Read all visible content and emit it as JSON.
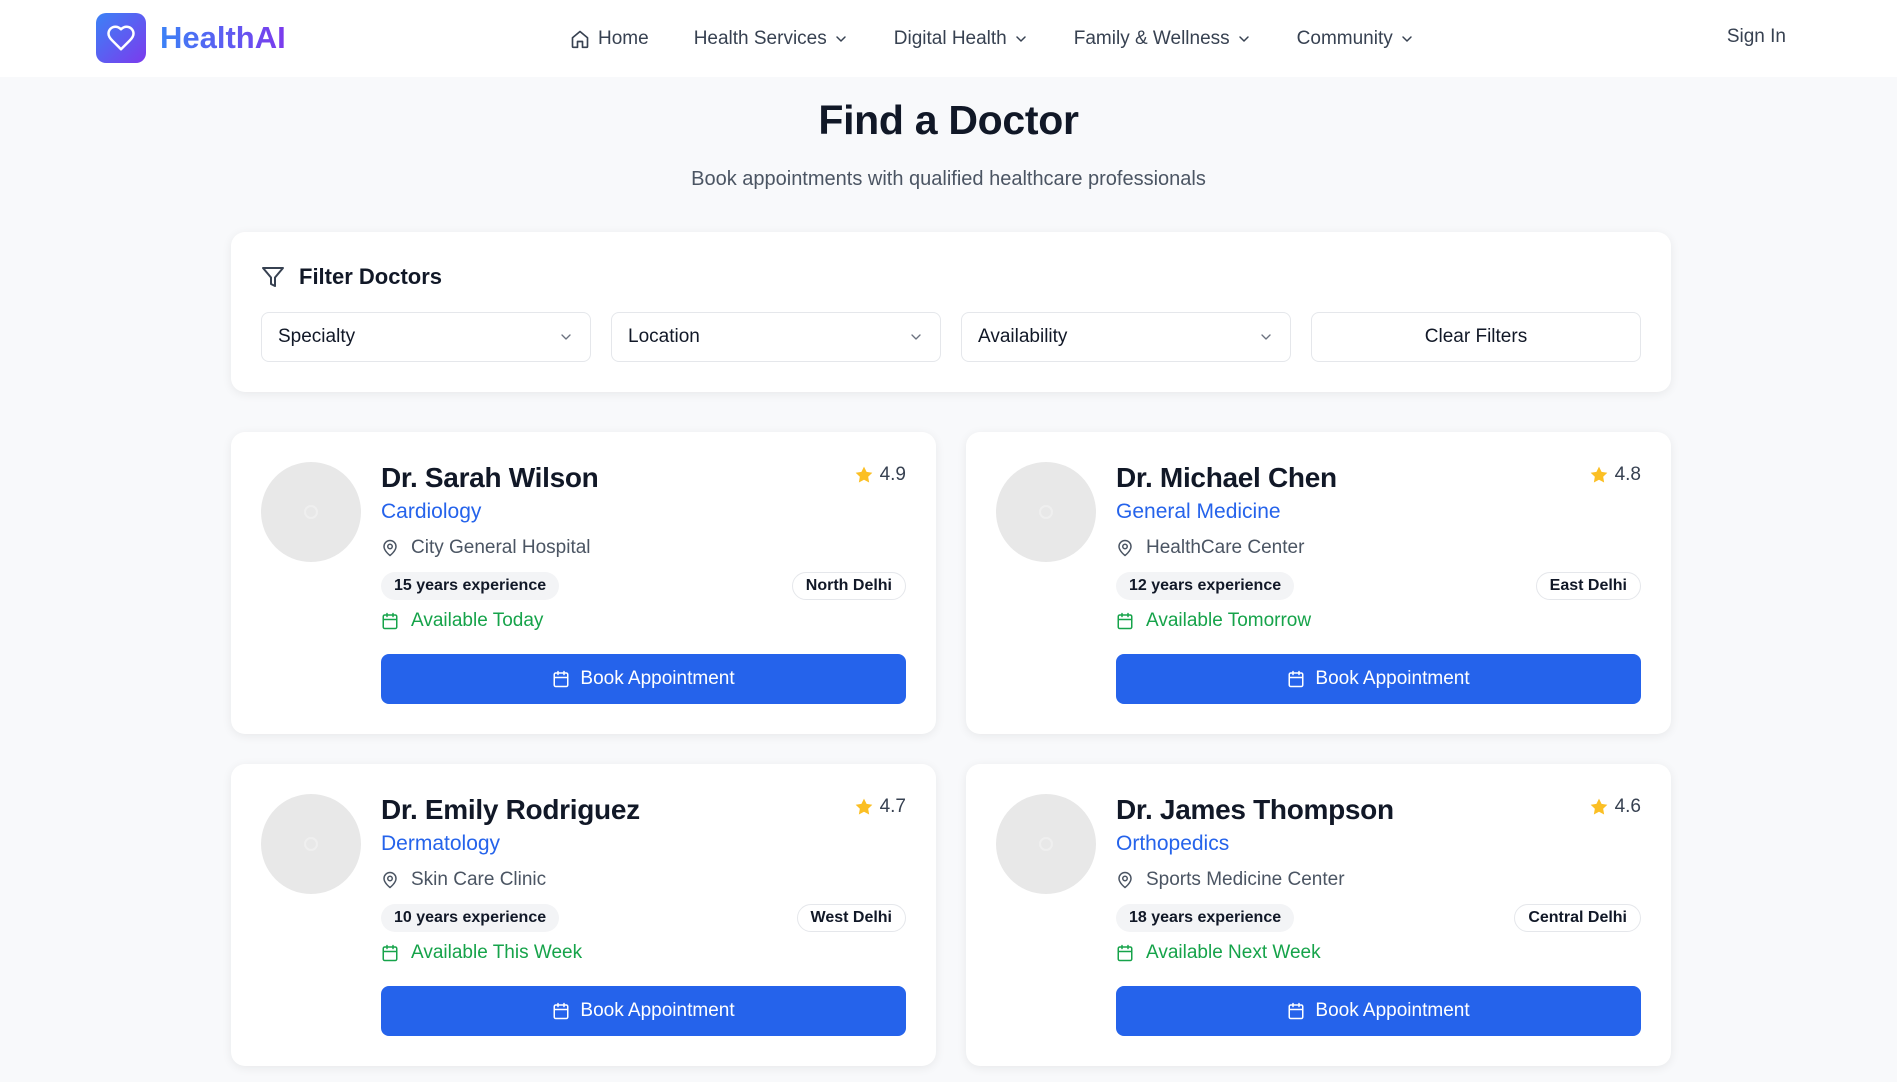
{
  "brand": {
    "name": "HealthAI",
    "icon": "heart-icon"
  },
  "nav": {
    "home": "Home",
    "items": [
      "Health Services",
      "Digital Health",
      "Family & Wellness",
      "Community"
    ],
    "sign_in": "Sign In"
  },
  "page": {
    "title": "Find a Doctor",
    "subtitle": "Book appointments with qualified healthcare professionals"
  },
  "filters": {
    "title": "Filter Doctors",
    "specialty": "Specialty",
    "location": "Location",
    "availability": "Availability",
    "clear": "Clear Filters"
  },
  "colors": {
    "accent": "#2563eb",
    "available": "#16a34a",
    "star": "#fbbf24",
    "brand_gradient_start": "#3b82f6",
    "brand_gradient_end": "#7c3aed"
  },
  "doctors": [
    {
      "name": "Dr. Sarah Wilson",
      "specialty": "Cardiology",
      "rating": "4.9",
      "hospital": "City General Hospital",
      "experience": "15 years experience",
      "area": "North Delhi",
      "availability": "Available Today",
      "button": "Book Appointment"
    },
    {
      "name": "Dr. Michael Chen",
      "specialty": "General Medicine",
      "rating": "4.8",
      "hospital": "HealthCare Center",
      "experience": "12 years experience",
      "area": "East Delhi",
      "availability": "Available Tomorrow",
      "button": "Book Appointment"
    },
    {
      "name": "Dr. Emily Rodriguez",
      "specialty": "Dermatology",
      "rating": "4.7",
      "hospital": "Skin Care Clinic",
      "experience": "10 years experience",
      "area": "West Delhi",
      "availability": "Available This Week",
      "button": "Book Appointment"
    },
    {
      "name": "Dr. James Thompson",
      "specialty": "Orthopedics",
      "rating": "4.6",
      "hospital": "Sports Medicine Center",
      "experience": "18 years experience",
      "area": "Central Delhi",
      "availability": "Available Next Week",
      "button": "Book Appointment"
    }
  ]
}
